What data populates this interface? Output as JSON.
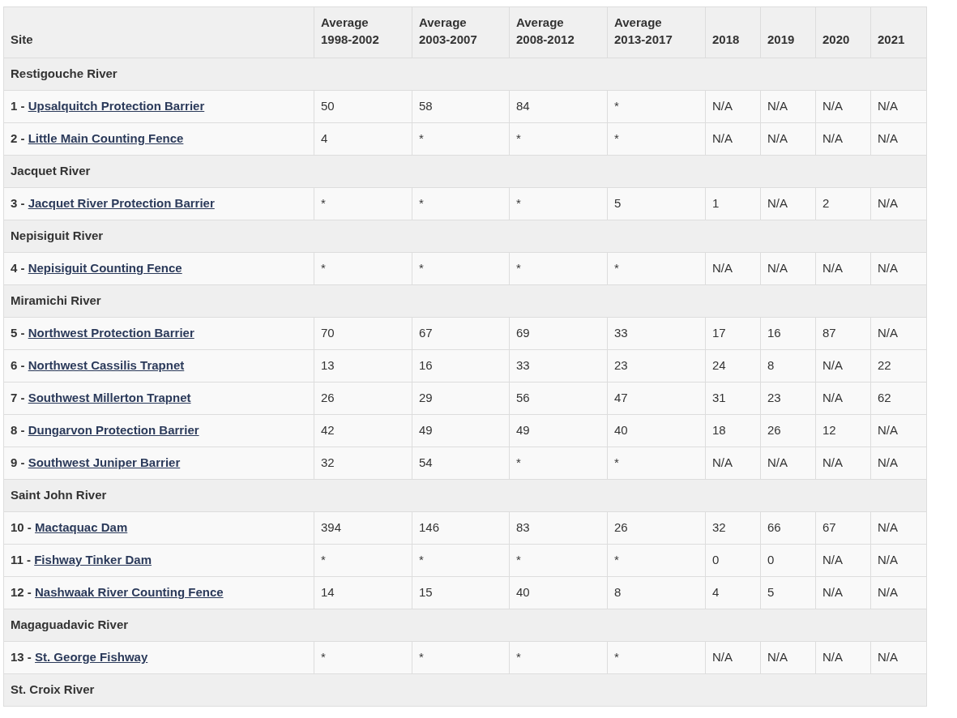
{
  "table": {
    "columns": [
      "Site",
      "Average 1998-2002",
      "Average 2003-2007",
      "Average 2008-2012",
      "Average 2013-2017",
      "2018",
      "2019",
      "2020",
      "2021"
    ],
    "groups": [
      {
        "river": "Restigouche River",
        "sites": [
          {
            "number": "1 -",
            "name": "Upsalquitch Protection Barrier",
            "values": [
              "50",
              "58",
              "84",
              "*",
              "N/A",
              "N/A",
              "N/A",
              "N/A"
            ]
          },
          {
            "number": "2 -",
            "name": "Little Main Counting Fence",
            "values": [
              "4",
              "*",
              "*",
              "*",
              "N/A",
              "N/A",
              "N/A",
              "N/A"
            ]
          }
        ]
      },
      {
        "river": "Jacquet River",
        "sites": [
          {
            "number": "3 -",
            "name": "Jacquet River Protection Barrier",
            "values": [
              "*",
              "*",
              "*",
              "5",
              "1",
              "N/A",
              "2",
              "N/A"
            ]
          }
        ]
      },
      {
        "river": "Nepisiguit River",
        "sites": [
          {
            "number": "4 -",
            "name": "Nepisiguit Counting Fence",
            "values": [
              "*",
              "*",
              "*",
              "*",
              "N/A",
              "N/A",
              "N/A",
              "N/A"
            ]
          }
        ]
      },
      {
        "river": "Miramichi River",
        "sites": [
          {
            "number": "5 -",
            "name": "Northwest Protection Barrier",
            "values": [
              "70",
              "67",
              "69",
              "33",
              "17",
              "16",
              "87",
              "N/A"
            ]
          },
          {
            "number": "6 -",
            "name": "Northwest Cassilis Trapnet",
            "values": [
              "13",
              "16",
              "33",
              "23",
              "24",
              "8",
              "N/A",
              "22"
            ]
          },
          {
            "number": "7 -",
            "name": "Southwest Millerton Trapnet",
            "values": [
              "26",
              "29",
              "56",
              "47",
              "31",
              "23",
              "N/A",
              "62"
            ]
          },
          {
            "number": "8 -",
            "name": "Dungarvon Protection Barrier",
            "values": [
              "42",
              "49",
              "49",
              "40",
              "18",
              "26",
              "12",
              "N/A"
            ]
          },
          {
            "number": "9 -",
            "name": "Southwest Juniper Barrier",
            "values": [
              "32",
              "54",
              "*",
              "*",
              "N/A",
              "N/A",
              "N/A",
              "N/A"
            ]
          }
        ]
      },
      {
        "river": "Saint John River",
        "sites": [
          {
            "number": "10 -",
            "name": "Mactaquac Dam",
            "values": [
              "394",
              "146",
              "83",
              "26",
              "32",
              "66",
              "67",
              "N/A"
            ]
          },
          {
            "number": "11 -",
            "name": "Fishway Tinker Dam",
            "values": [
              "*",
              "*",
              "*",
              "*",
              "0",
              "0",
              "N/A",
              "N/A"
            ]
          },
          {
            "number": "12 -",
            "name": "Nashwaak River Counting Fence",
            "values": [
              "14",
              "15",
              "40",
              "8",
              "4",
              "5",
              "N/A",
              "N/A"
            ]
          }
        ]
      },
      {
        "river": "Magaguadavic River",
        "sites": [
          {
            "number": "13 -",
            "name": "St. George Fishway",
            "values": [
              "*",
              "*",
              "*",
              "*",
              "N/A",
              "N/A",
              "N/A",
              "N/A"
            ]
          }
        ]
      },
      {
        "river": "St. Croix River"
      }
    ]
  }
}
